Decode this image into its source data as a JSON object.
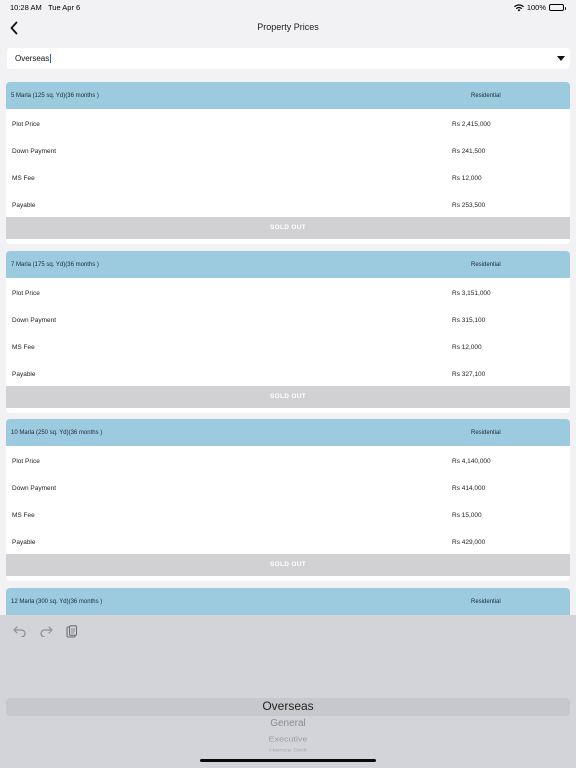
{
  "status_bar": {
    "time": "10:28 AM",
    "date": "Tue Apr 6",
    "battery": "100%"
  },
  "nav": {
    "title": "Property Prices",
    "back_icon": "chevron-left-icon"
  },
  "dropdown": {
    "value": "Overseas"
  },
  "cards": [
    {
      "title": "5 Marla (125 sq. Yd)(36 months )",
      "type": "Residential",
      "rows": [
        {
          "label": "Plot Price",
          "value": "Rs 2,415,000"
        },
        {
          "label": "Down Payment",
          "value": "Rs 241,500"
        },
        {
          "label": "MS Fee",
          "value": "Rs 12,000"
        },
        {
          "label": "Payable",
          "value": "Rs 253,500"
        }
      ],
      "status": "SOLD OUT"
    },
    {
      "title": "7 Marla (175 sq. Yd)(36 months )",
      "type": "Residential",
      "rows": [
        {
          "label": "Plot Price",
          "value": "Rs 3,151,000"
        },
        {
          "label": "Down Payment",
          "value": "Rs 315,100"
        },
        {
          "label": "MS Fee",
          "value": "Rs 12,000"
        },
        {
          "label": "Payable",
          "value": "Rs 327,100"
        }
      ],
      "status": "SOLD OUT"
    },
    {
      "title": "10 Marla (250 sq. Yd)(36 months )",
      "type": "Residential",
      "rows": [
        {
          "label": "Plot Price",
          "value": "Rs 4,140,000"
        },
        {
          "label": "Down Payment",
          "value": "Rs 414,000"
        },
        {
          "label": "MS Fee",
          "value": "Rs 15,000"
        },
        {
          "label": "Payable",
          "value": "Rs 429,000"
        }
      ],
      "status": "SOLD OUT"
    },
    {
      "title": "12 Marla (300 sq. Yd)(36 months )",
      "type": "Residential"
    }
  ],
  "picker": {
    "options": [
      "Overseas",
      "General",
      "Executive",
      "Hamza Dick"
    ],
    "selected": "Overseas"
  },
  "colors": {
    "card_header": "#9ccbe0",
    "sold_out": "#d1d1d3",
    "keyboard": "#d3d4da"
  }
}
